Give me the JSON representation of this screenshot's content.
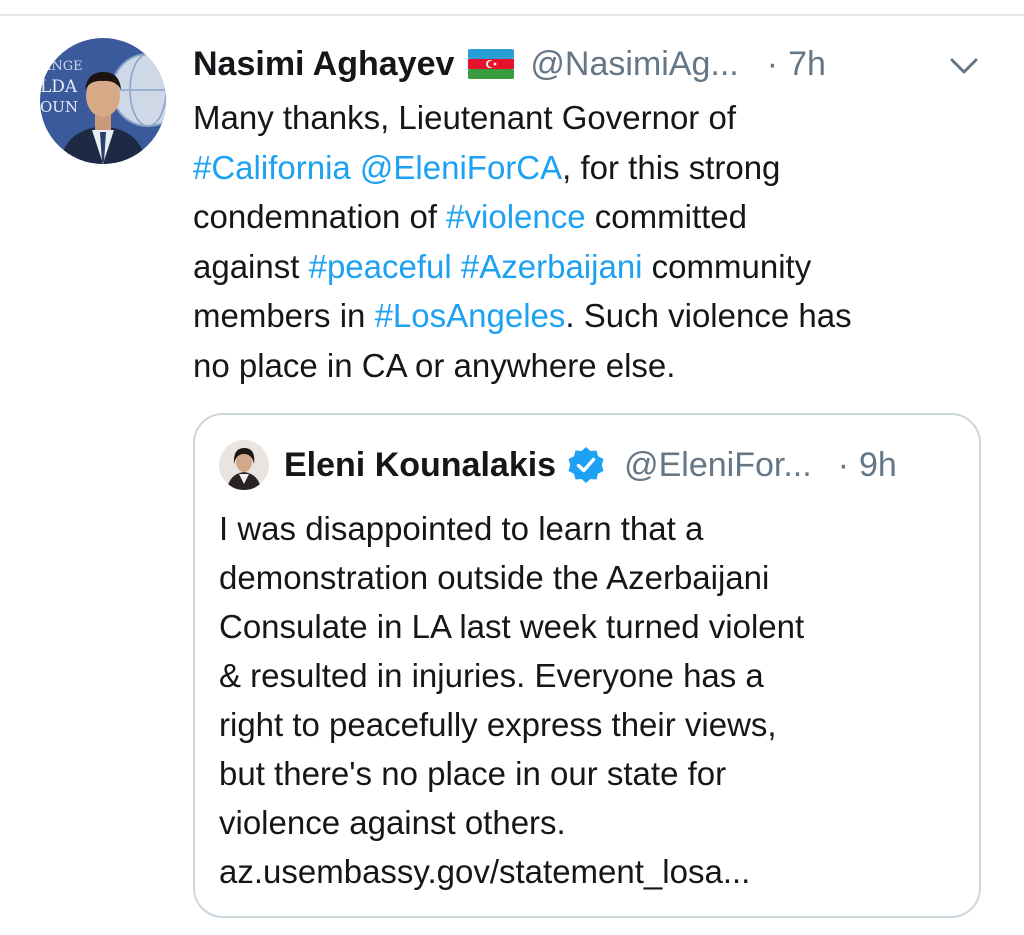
{
  "tweet": {
    "author_name": "Nasimi Aghayev",
    "flag_icon": "azerbaijan-flag",
    "handle": "@NasimiAg...",
    "separator": "·",
    "time": "7h",
    "text_segments": [
      [
        {
          "text": "Many thanks, Lieutenant Governor of"
        }
      ],
      [
        {
          "text": "#California",
          "link": true
        },
        {
          "text": " "
        },
        {
          "text": "@EleniForCA",
          "link": true
        },
        {
          "text": ", for this strong"
        }
      ],
      [
        {
          "text": "condemnation of "
        },
        {
          "text": "#violence",
          "link": true
        },
        {
          "text": " committed"
        }
      ],
      [
        {
          "text": "against "
        },
        {
          "text": "#peaceful",
          "link": true
        },
        {
          "text": " "
        },
        {
          "text": "#Azerbaijani",
          "link": true
        },
        {
          "text": " community"
        }
      ],
      [
        {
          "text": "members in "
        },
        {
          "text": "#LosAngeles",
          "link": true
        },
        {
          "text": ". Such violence has"
        }
      ],
      [
        {
          "text": "no place in CA or anywhere else."
        }
      ]
    ]
  },
  "quoted_tweet": {
    "author_name": "Eleni Kounalakis",
    "verified_icon": "verified-badge-icon",
    "handle": "@EleniFor...",
    "separator": "·",
    "time": "9h",
    "text_lines": [
      "I was disappointed to learn that a",
      "demonstration outside the Azerbaijani",
      "Consulate in LA last week turned violent",
      "& resulted in injuries. Everyone has a",
      "right to peacefully express their views,",
      "but there's no place in our state for",
      "violence against others.",
      "az.usembassy.gov/statement_losa..."
    ]
  },
  "colors": {
    "link": "#1da1f2",
    "text": "#14171a",
    "muted": "#657786",
    "border": "#ccd6dd",
    "verified": "#1da1f2"
  }
}
